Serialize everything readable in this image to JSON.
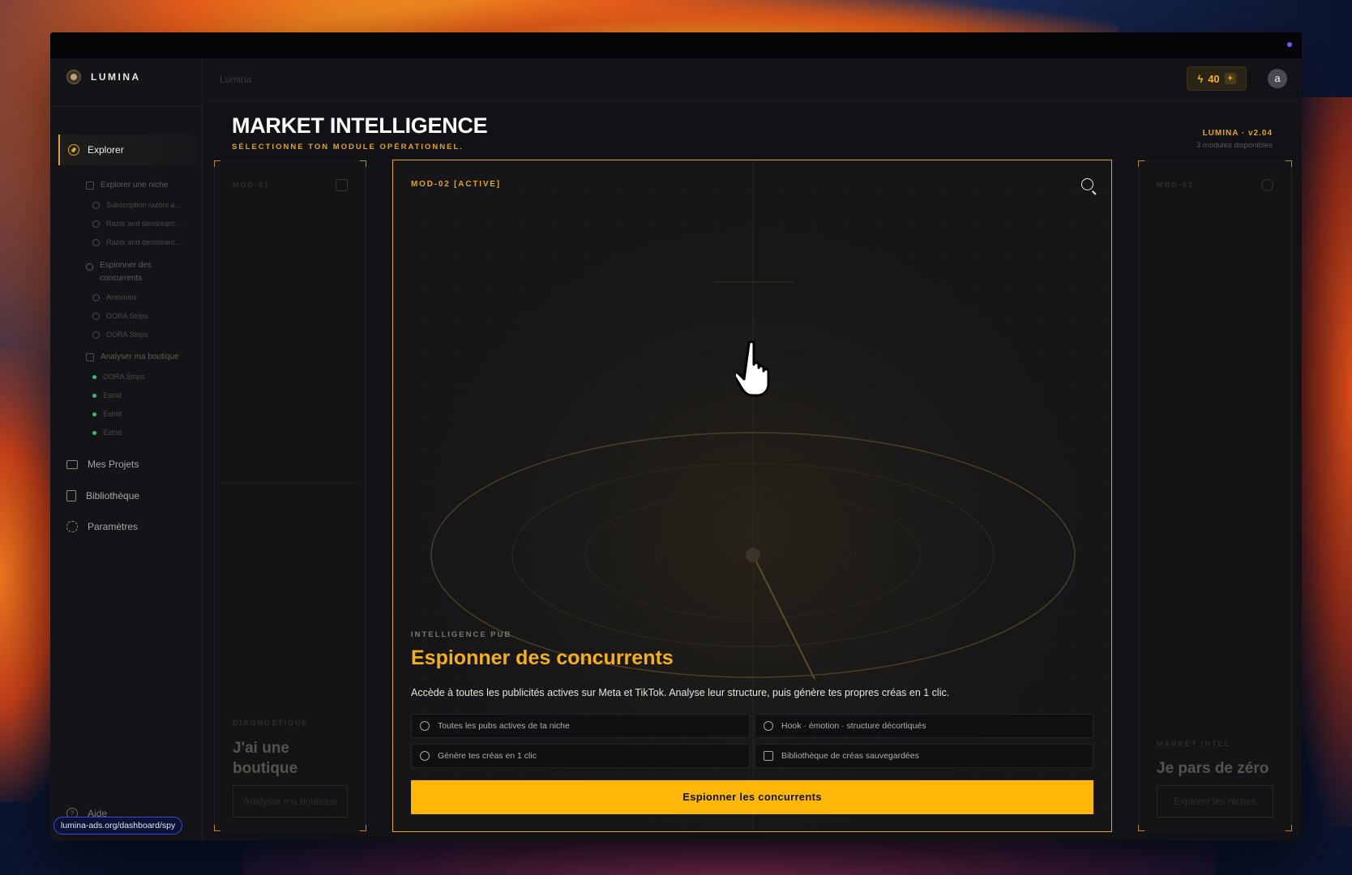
{
  "brand": {
    "name": "LUMINA"
  },
  "sidebar": {
    "explorer": "Explorer",
    "explore_niche": "Explorer une niche",
    "niche_history": [
      "Subscription razors a...",
      "Razor and deodorant ...",
      "Razor and deodorant ..."
    ],
    "spy_competitors": [
      "Espionner des",
      "concurrents"
    ],
    "spy_history": [
      "Amoonoir",
      "OORA Strips",
      "OORA Strips"
    ],
    "analyze_shop": "Analyser ma boutique",
    "shop_history": [
      "OORA Strips",
      "Estrid",
      "Estrid",
      "Estrid"
    ],
    "projects": "Mes Projets",
    "library": "Bibliothèque",
    "settings": "Paramètres",
    "help": "Aide",
    "url": "lumina-ads.org/dashboard/spy"
  },
  "topbar": {
    "breadcrumb": "Lumina",
    "credits": "40",
    "avatar_initial": "a"
  },
  "header": {
    "title": "MARKET INTELLIGENCE",
    "subtitle": "SÉLECTIONNE TON MODULE OPÉRATIONNEL.",
    "version": "LUMINA · v2.04",
    "module_count": "3 modules disponibles"
  },
  "modules": {
    "left": {
      "code": "MOD-01",
      "tag": "DIAGNOSTIQUE",
      "title_line1": "J'ai une",
      "title_line2": "boutique",
      "cta": "Analyser ma boutique"
    },
    "main": {
      "code": "MOD-02 [ACTIVE]",
      "tag": "INTELLIGENCE PUB",
      "title": "Espionner des concurrents",
      "description": "Accède à toutes les publicités actives sur Meta et TikTok. Analyse leur structure, puis génère tes propres créas en 1 clic.",
      "features": [
        "Toutes les pubs actives de ta niche",
        "Hook · émotion · structure décortiqués",
        "Génère tes créas en 1 clic",
        "Bibliothèque de créas sauvegardées"
      ],
      "cta": "Espionner les concurrents"
    },
    "right": {
      "code": "MOD-03",
      "tag": "MARKET INTEL",
      "title": "Je pars de zéro",
      "cta": "Explorer les niches"
    }
  },
  "colors": {
    "accent": "#e0a520",
    "cta": "#ffb80a",
    "status_green": "#2fbf71"
  }
}
